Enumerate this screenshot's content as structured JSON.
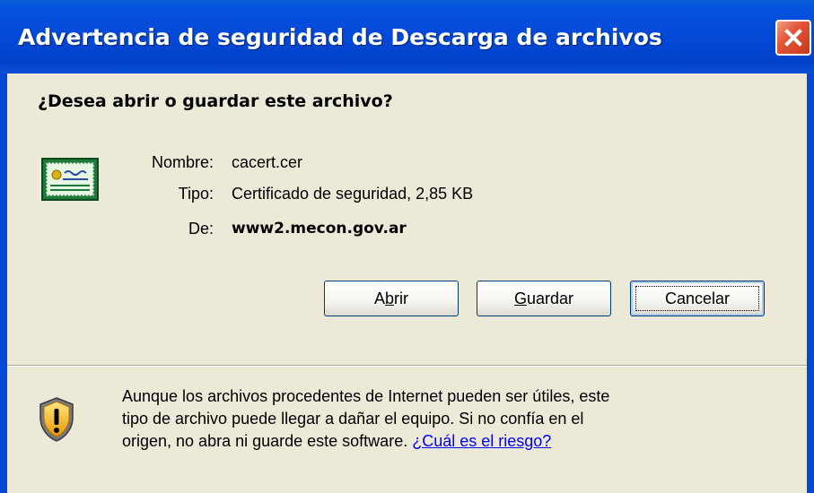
{
  "window": {
    "title": "Advertencia de seguridad de Descarga de archivos",
    "close_icon": "close-icon",
    "accent_color": "#0348d6",
    "close_color": "#e2553a"
  },
  "dialog": {
    "question": "¿Desea abrir o guardar este archivo?",
    "file_icon": "certificate-file-icon",
    "fields": {
      "name_label": "Nombre:",
      "name_value": "cacert.cer",
      "type_label": "Tipo:",
      "type_value": "Certificado de seguridad, 2,85 KB",
      "from_label": "De:",
      "from_value": "www2.mecon.gov.ar"
    },
    "buttons": {
      "open": {
        "label": "Abrir",
        "before": "A",
        "accel": "b",
        "after": "rir"
      },
      "save": {
        "label": "Guardar",
        "before": "",
        "accel": "G",
        "after": "uardar"
      },
      "cancel": {
        "label": "Cancelar"
      }
    }
  },
  "warning": {
    "icon": "warning-shield-icon",
    "line1": "Aunque los archivos procedentes de Internet pueden ser útiles, este",
    "line2": "tipo de archivo puede llegar a dañar el equipo. Si no confía en el",
    "line3": "origen, no abra ni guarde este software.",
    "link": "¿Cuál es el riesgo?",
    "link_color": "#0000ff"
  }
}
